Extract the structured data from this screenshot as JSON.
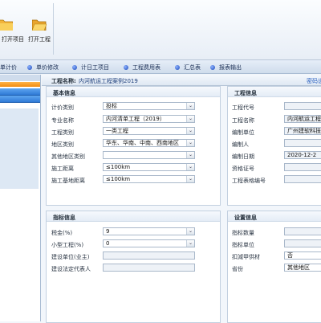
{
  "toolbar": {
    "open_project_label": "打开项目",
    "open_work_label": "打开工程"
  },
  "navbar": {
    "items": [
      "单计价",
      "单价修改",
      "计日工项目",
      "工程费用表",
      "汇总表",
      "报表输出"
    ]
  },
  "project": {
    "name_label": "工程名称:",
    "name_value": "内河航运工程案例2019",
    "password_label": "密码设"
  },
  "basic_info": {
    "title": "基本信息",
    "fields": [
      {
        "label": "计价类别",
        "value": "投标"
      },
      {
        "label": "专业名称",
        "value": "内河清单工程（2019）"
      },
      {
        "label": "工程类别",
        "value": "一类工程"
      },
      {
        "label": "地区类别",
        "value": "华东、华南、中南、西南地区"
      },
      {
        "label": "其他地区类别",
        "value": ""
      },
      {
        "label": "施工距离",
        "value": "≤100km"
      },
      {
        "label": "施工基地距离",
        "value": "≤100km"
      }
    ]
  },
  "project_info": {
    "title": "工程信息",
    "fields": [
      {
        "label": "工程代号",
        "value": ""
      },
      {
        "label": "工程名称",
        "value": "内河航运工程"
      },
      {
        "label": "编制单位",
        "value": "广州建软科技"
      },
      {
        "label": "编制人",
        "value": ""
      },
      {
        "label": "编制日期",
        "value": "2020-12-2"
      },
      {
        "label": "资格证号",
        "value": ""
      },
      {
        "label": "工程表格编号",
        "value": ""
      }
    ]
  },
  "index_info": {
    "title": "指标信息",
    "fields": [
      {
        "label": "税金(%)",
        "value": "9"
      },
      {
        "label": "小型工程(%)",
        "value": "0"
      },
      {
        "label": "建设单位(业主)",
        "value": ""
      },
      {
        "label": "建设法定代表人",
        "value": ""
      }
    ]
  },
  "settings_info": {
    "title": "设置信息",
    "fields": [
      {
        "label": "指标数量",
        "value": ""
      },
      {
        "label": "指标单位",
        "value": ""
      },
      {
        "label": "扣減甲供材",
        "value": "否"
      },
      {
        "label": "省份",
        "value": "其他地区"
      }
    ]
  }
}
